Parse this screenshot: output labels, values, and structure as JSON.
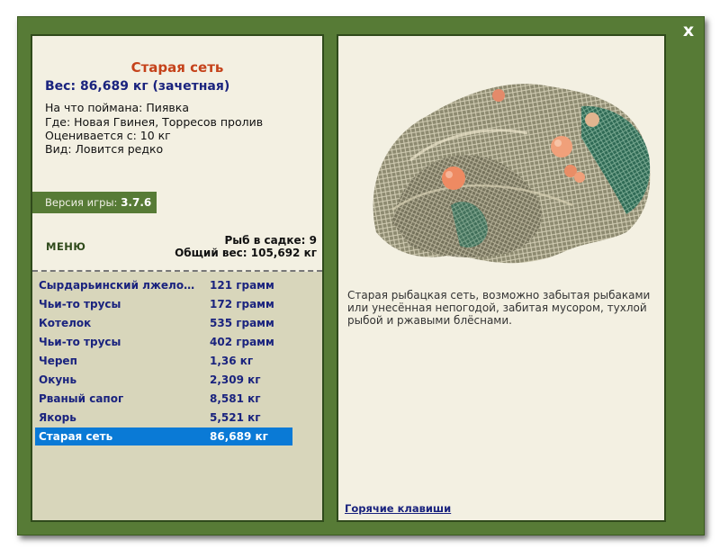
{
  "close_label": "x",
  "item": {
    "title": "Старая сеть",
    "weight": "Вес: 86,689 кг (зачетная)",
    "caught_on": "На что поймана: Пиявка",
    "location": "Где: Новая Гвинея, Торресов пролив",
    "valued_from": "Оценивается с: 10 кг",
    "rarity": "Вид: Ловится редко",
    "description": "Старая рыбацкая сеть, возможно забытая рыбаками или унесённая непогодой, забитая мусором, тухлой рыбой и ржавыми блёснами."
  },
  "version": {
    "label": "Версия игры:",
    "value": "3.7.6"
  },
  "menu_label": "МЕНЮ",
  "stats": {
    "fish_in_keepnet": "Рыб в садке: 9",
    "total_weight": "Общий вес: 105,692 кг"
  },
  "catch_list": [
    {
      "name": "Сырдарьинский лжелопатонос",
      "weight": "121 грамм"
    },
    {
      "name": "Чьи-то трусы",
      "weight": "172 грамм"
    },
    {
      "name": "Котелок",
      "weight": "535 грамм"
    },
    {
      "name": "Чьи-то трусы",
      "weight": "402 грамм"
    },
    {
      "name": "Череп",
      "weight": "1,36 кг"
    },
    {
      "name": "Окунь",
      "weight": "2,309 кг"
    },
    {
      "name": "Рваный сапог",
      "weight": "8,581 кг"
    },
    {
      "name": "Якорь",
      "weight": "5,521 кг"
    },
    {
      "name": "Старая сеть",
      "weight": "86,689 кг"
    }
  ],
  "selected_index": 8,
  "hotkeys_label": "Горячие клавиши",
  "colors": {
    "frame_green": "#577b36",
    "panel_bg": "#f3f0e2",
    "title_orange": "#c5421a",
    "text_navy": "#1a237e",
    "selection_blue": "#0a7ad6"
  }
}
